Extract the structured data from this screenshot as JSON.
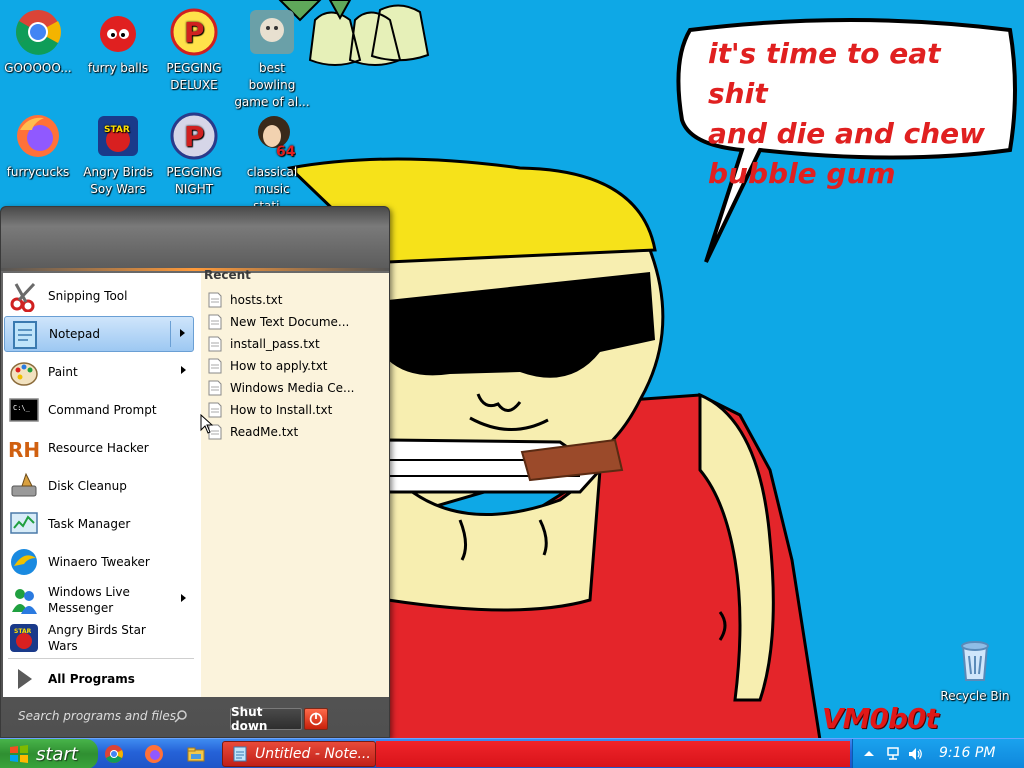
{
  "desktop": {
    "icons": [
      {
        "label": "GOOOOO...",
        "icon": "chrome-icon"
      },
      {
        "label": "furry balls",
        "icon": "furry-ball-icon"
      },
      {
        "label": "PEGGING\nDELUXE",
        "icon": "peggle-deluxe-icon"
      },
      {
        "label": "best bowling\ngame of al...",
        "icon": "bowling-game-icon"
      },
      {
        "label": "furrycucks",
        "icon": "firefox-icon"
      },
      {
        "label": "Angry Birds\nSoy Wars",
        "icon": "angry-birds-star-wars-icon"
      },
      {
        "label": "PEGGING\nNIGHT",
        "icon": "peggle-night-icon"
      },
      {
        "label": "classical\nmusic stati...",
        "icon": "classical-music-icon"
      },
      {
        "label": "Recycle Bin",
        "icon": "recycle-bin-icon"
      }
    ]
  },
  "wallpaper": {
    "speech_bubble": "it's time to eat shit\nand die and chew\nbubble gum",
    "signature": "VM0b0t"
  },
  "start_menu": {
    "programs": [
      {
        "label": "Snipping Tool",
        "icon": "scissors-icon",
        "submenu": false
      },
      {
        "label": "Notepad",
        "icon": "notepad-icon",
        "submenu": true,
        "selected": true
      },
      {
        "label": "Paint",
        "icon": "paint-palette-icon",
        "submenu": true
      },
      {
        "label": "Command Prompt",
        "icon": "command-prompt-icon",
        "submenu": false
      },
      {
        "label": "Resource Hacker",
        "icon": "resource-hacker-icon",
        "submenu": false
      },
      {
        "label": "Disk Cleanup",
        "icon": "disk-cleanup-icon",
        "submenu": false
      },
      {
        "label": "Task Manager",
        "icon": "task-manager-icon",
        "submenu": false
      },
      {
        "label": "Winaero Tweaker",
        "icon": "winaero-tweaker-icon",
        "submenu": false
      },
      {
        "label": "Windows Live\nMessenger",
        "icon": "messenger-icon",
        "submenu": true
      },
      {
        "label": "Angry Birds Star\nWars",
        "icon": "angry-birds-star-wars-icon",
        "submenu": false
      }
    ],
    "all_programs": "All Programs",
    "recent_title": "Recent",
    "recent_items": [
      "hosts.txt",
      "New Text Docume...",
      "install_pass.txt",
      "How to apply.txt",
      "Windows Media Ce...",
      "How to Install.txt",
      "ReadMe.txt"
    ],
    "search_placeholder": "Search programs and files",
    "shutdown_label": "Shut down"
  },
  "taskbar": {
    "start_label": "start",
    "quick_launch": [
      "chrome-icon",
      "firefox-icon",
      "file-explorer-icon"
    ],
    "active_task": "Untitled - Note...",
    "clock": "9:16 PM",
    "tray_icons": [
      "show-hidden-icons-chevron",
      "network-icon",
      "volume-icon"
    ]
  },
  "colors": {
    "desktop_bg": "#0ea8e6",
    "taskbar_blue": "#2562d8",
    "start_green": "#3aa53c",
    "speech_red": "#e02020",
    "selected_item": "#9dc8f2",
    "recent_pane": "#fbf3dc"
  }
}
